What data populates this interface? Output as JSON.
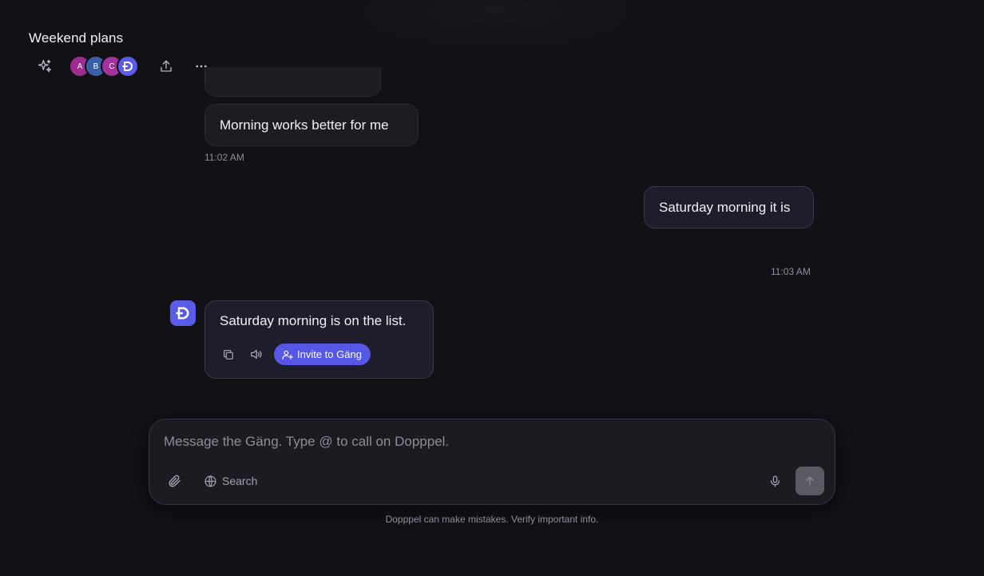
{
  "chat": {
    "title": "Weekend plans",
    "participants": [
      {
        "initial": "A",
        "color": "#9c2d8f"
      },
      {
        "initial": "B",
        "color": "#3a5fa8"
      },
      {
        "initial": "C",
        "color": "#a2339b"
      },
      {
        "initial": "",
        "icon": "dopppel-logo-icon",
        "color": "#5a5be8"
      }
    ]
  },
  "toolbar": {
    "sparkle_icon": "sparkle-icon",
    "share_icon": "share-icon",
    "more_icon": "more-horizontal-icon"
  },
  "messages": [
    {
      "author": "member",
      "text": "Morning works better for me",
      "time": "11:02 AM"
    },
    {
      "author": "user",
      "text": "Saturday morning it is",
      "time": "11:03 AM"
    },
    {
      "author": "dopppel",
      "text": "Saturday morning is on the list.",
      "actions": {
        "copy_icon": "copy-icon",
        "speak_icon": "speaker-icon",
        "invite_label": "Invite to Gäng"
      }
    }
  ],
  "composer": {
    "placeholder": "Message the Gäng. Type @ to call on Dopppel.",
    "search_label": "Search",
    "attach_icon": "paperclip-icon",
    "globe_icon": "globe-icon",
    "mic_icon": "microphone-icon",
    "send_icon": "arrow-up-icon"
  },
  "disclaimer": "Dopppel can make mistakes. Verify important info.",
  "colors": {
    "background": "#111116",
    "accent": "#5757e5",
    "bubble": "#1c1c22",
    "bubble_self": "#1e1d2c"
  }
}
